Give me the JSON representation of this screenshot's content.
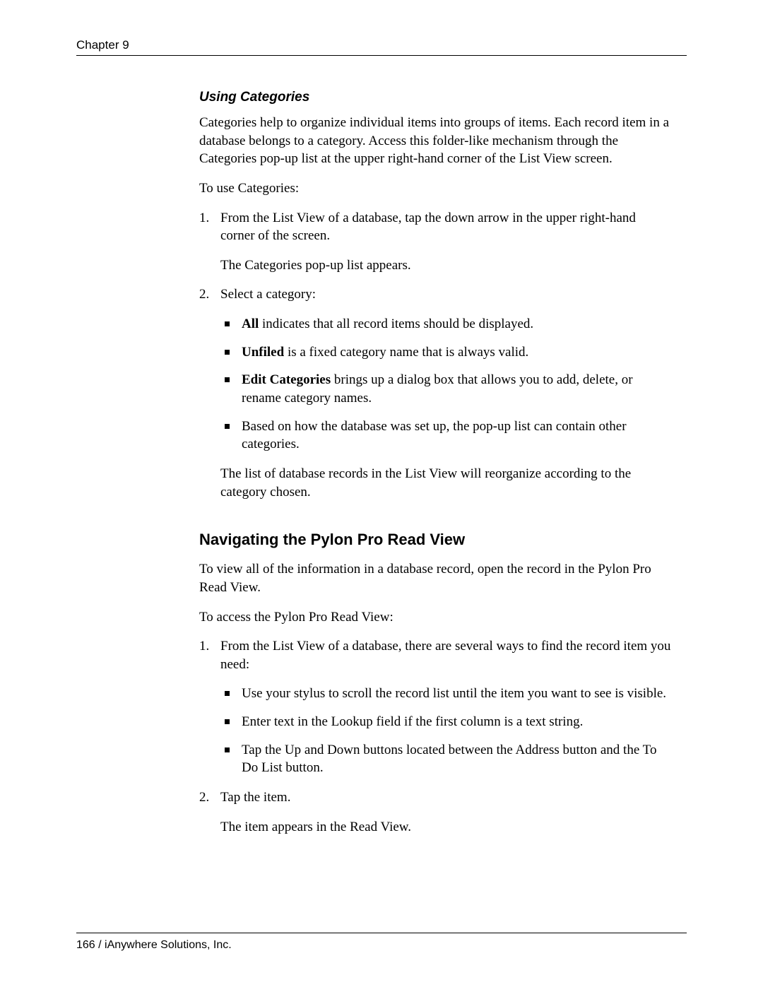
{
  "header": {
    "chapter": "Chapter 9"
  },
  "section1": {
    "title": "Using Categories",
    "intro": "Categories help to organize individual items into groups of items. Each record item in a database belongs to a category. Access this folder-like mechanism through the Categories pop-up list at the upper right-hand corner of the List View screen.",
    "lead": "To use Categories:",
    "step1": "From the List View of a database, tap the down arrow in the upper right-hand corner of the screen.",
    "step1_result": "The Categories pop-up list appears.",
    "step2": "Select a category:",
    "bullet1_bold": "All",
    "bullet1_rest": " indicates that all record items should be displayed.",
    "bullet2_bold": "Unfiled",
    "bullet2_rest": " is a fixed category name that is always valid.",
    "bullet3_bold": "Edit Categories",
    "bullet3_rest": " brings up a dialog box that allows you to add, delete, or rename category names.",
    "bullet4": "Based on how the database was set up, the pop-up list can contain other categories.",
    "step2_result": "The list of database records in the List View will reorganize according to the category chosen."
  },
  "section2": {
    "title": "Navigating the Pylon Pro Read View",
    "intro": "To view all of the information in a database record, open the record in the Pylon Pro Read View.",
    "lead": "To access the Pylon Pro Read View:",
    "step1": "From the List View of a database, there are several ways to find the record item you need:",
    "bullet1": "Use your stylus to scroll the record list until the item you want to see is visible.",
    "bullet2": "Enter text in the Lookup field if the first column is a text string.",
    "bullet3": "Tap the Up and Down buttons located between the Address button and the To Do List button.",
    "step2": "Tap the item.",
    "step2_result": "The item appears in the Read View."
  },
  "footer": {
    "text": "166  /  iAnywhere Solutions, Inc."
  }
}
